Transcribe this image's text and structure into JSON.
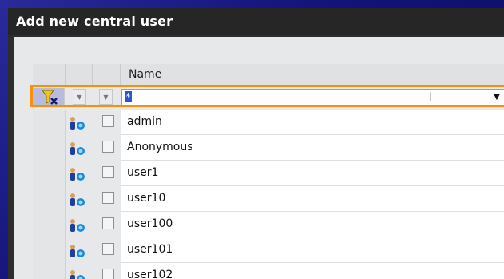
{
  "dialog": {
    "title": "Add new central user"
  },
  "grid": {
    "column_header": "Name",
    "filter": {
      "value": "*"
    },
    "rows": [
      {
        "name": "admin"
      },
      {
        "name": "Anonymous"
      },
      {
        "name": "user1"
      },
      {
        "name": "user10"
      },
      {
        "name": "user100"
      },
      {
        "name": "user101"
      },
      {
        "name": "user102"
      }
    ]
  },
  "colors": {
    "highlight": "#f5910f",
    "title_bg": "#262626",
    "frame": "#14147a"
  },
  "icons": {
    "filter": "filter-clear-icon",
    "user": "central-user-icon",
    "dropdown": "dropdown-arrow-icon"
  }
}
